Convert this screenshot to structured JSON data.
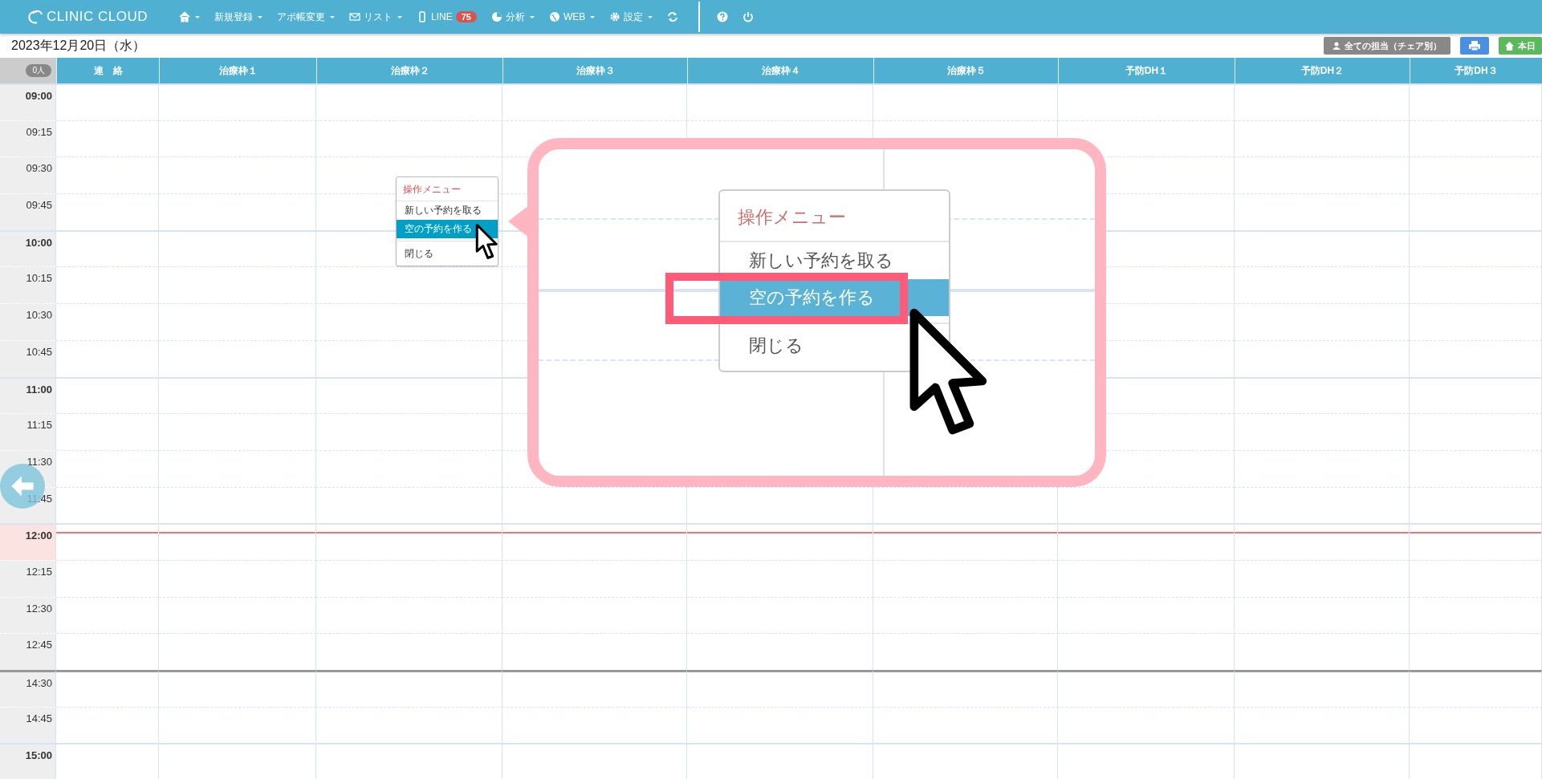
{
  "navbar": {
    "logo": "CLINIC CLOUD",
    "menus": [
      {
        "kind": "home",
        "dropdown": true
      },
      {
        "kind": "plain",
        "label": "新規登録",
        "dropdown": true
      },
      {
        "kind": "plain",
        "label": "アポ帳変更",
        "dropdown": true
      },
      {
        "kind": "envelope",
        "label": "リスト",
        "dropdown": true
      },
      {
        "kind": "phone",
        "label": "LINE",
        "dropdown": false,
        "badge": "75"
      },
      {
        "kind": "chart",
        "label": "分析",
        "dropdown": true
      },
      {
        "kind": "globe",
        "label": "WEB",
        "dropdown": true
      },
      {
        "kind": "gear",
        "label": "設定",
        "dropdown": true
      },
      {
        "kind": "refresh",
        "dropdown": false
      }
    ],
    "right_icons": [
      {
        "kind": "help"
      },
      {
        "kind": "power"
      }
    ]
  },
  "date": "2023年12月20日（水）",
  "toolbar_buttons": [
    {
      "kind": "staff",
      "label": "全ての担当（チェア別）"
    },
    {
      "kind": "print"
    },
    {
      "kind": "today",
      "label": "本日"
    }
  ],
  "schedule": {
    "count_badge": "0人",
    "columns": [
      "連　絡",
      "治療枠１",
      "治療枠２",
      "治療枠３",
      "治療枠４",
      "治療枠５",
      "予防DH１",
      "予防DH２",
      "予防DH３"
    ],
    "time_slots": [
      {
        "label": "09:00",
        "kind": "hour",
        "current": false,
        "after_gap": false
      },
      {
        "label": "09:15",
        "kind": "quarter",
        "current": false,
        "after_gap": false
      },
      {
        "label": "09:30",
        "kind": "quarter",
        "current": false,
        "after_gap": false
      },
      {
        "label": "09:45",
        "kind": "quarter",
        "current": false,
        "after_gap": false
      },
      {
        "label": "10:00",
        "kind": "hour",
        "current": false,
        "after_gap": false
      },
      {
        "label": "10:15",
        "kind": "quarter",
        "current": false,
        "after_gap": false
      },
      {
        "label": "10:30",
        "kind": "quarter",
        "current": false,
        "after_gap": false
      },
      {
        "label": "10:45",
        "kind": "quarter",
        "current": false,
        "after_gap": false
      },
      {
        "label": "11:00",
        "kind": "hour",
        "current": false,
        "after_gap": false
      },
      {
        "label": "11:15",
        "kind": "quarter",
        "current": false,
        "after_gap": false
      },
      {
        "label": "11:30",
        "kind": "quarter",
        "current": false,
        "after_gap": false
      },
      {
        "label": "11:45",
        "kind": "quarter",
        "current": false,
        "after_gap": false
      },
      {
        "label": "12:00",
        "kind": "hour",
        "current": true,
        "after_gap": false
      },
      {
        "label": "12:15",
        "kind": "quarter",
        "current": false,
        "after_gap": false
      },
      {
        "label": "12:30",
        "kind": "quarter",
        "current": false,
        "after_gap": false
      },
      {
        "label": "12:45",
        "kind": "quarter",
        "current": false,
        "after_gap": false
      },
      {
        "label": "14:30",
        "kind": "quarter",
        "current": false,
        "after_gap": true
      },
      {
        "label": "14:45",
        "kind": "quarter",
        "current": false,
        "after_gap": false
      },
      {
        "label": "15:00",
        "kind": "hour",
        "current": false,
        "after_gap": false
      }
    ]
  },
  "context_menu": {
    "title": "操作メニュー",
    "items": [
      {
        "label": "新しい予約を取る",
        "selected": false,
        "separated": false
      },
      {
        "label": "空の予約を作る",
        "selected": true,
        "separated": false
      },
      {
        "label": "閉じる",
        "selected": false,
        "separated": true
      }
    ]
  },
  "callout": {
    "title": "操作メニュー",
    "items": [
      {
        "label": "新しい予約を取る",
        "selected": false,
        "separated": false
      },
      {
        "label": "空の予約を作る",
        "selected": true,
        "separated": false
      },
      {
        "label": "閉じる",
        "selected": false,
        "separated": true
      }
    ]
  }
}
